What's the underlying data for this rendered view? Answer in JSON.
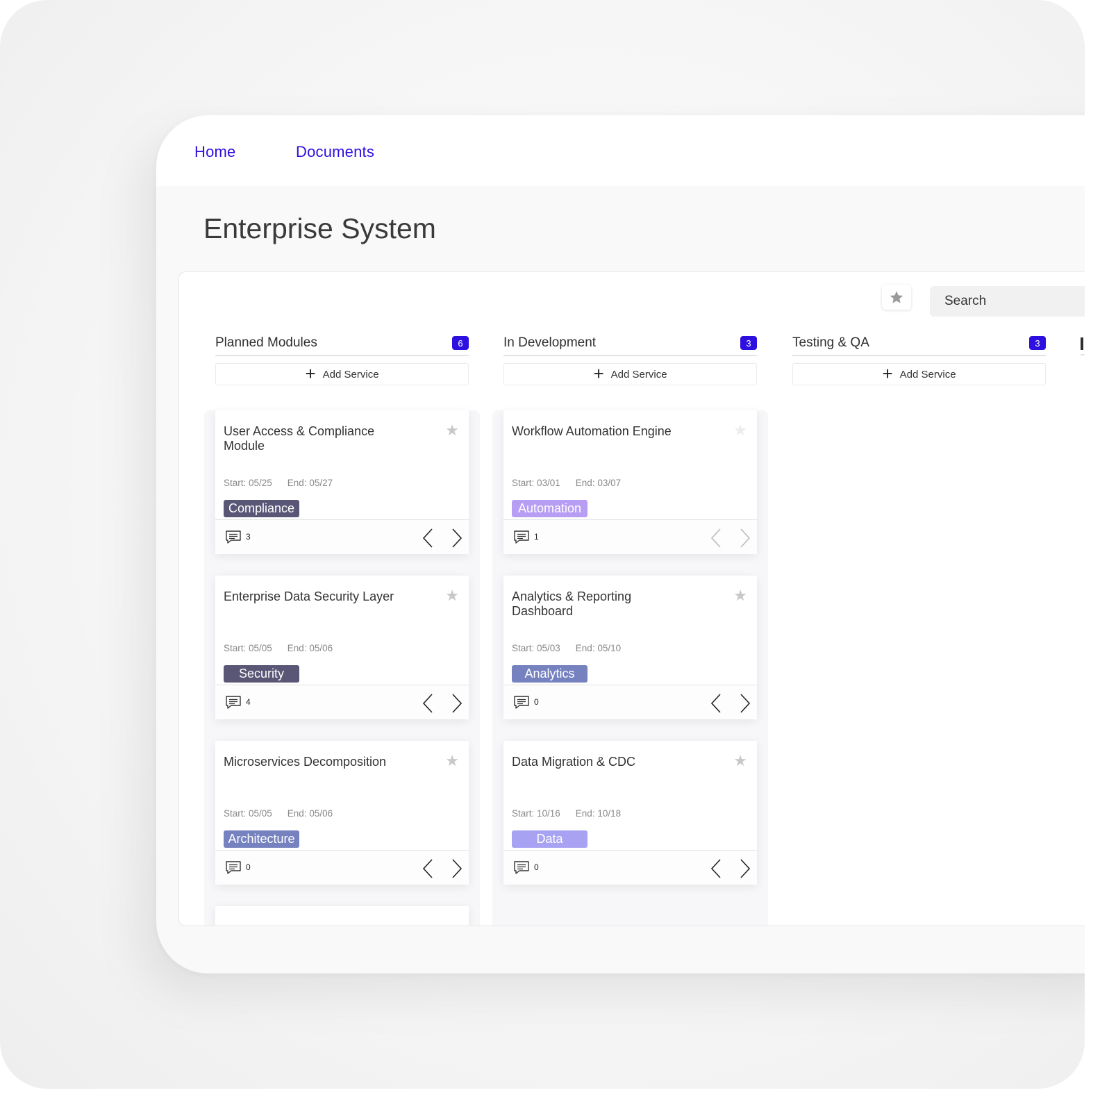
{
  "nav": {
    "home": "Home",
    "documents": "Documents"
  },
  "page_title": "Enterprise System",
  "toolbar": {
    "search_placeholder": "Search",
    "favorites_icon": "star-icon"
  },
  "colors": {
    "accent": "#2d0fe0",
    "tag_compliance": "#5a5676",
    "tag_security": "#5a5676",
    "tag_architecture": "#7582bf",
    "tag_automation": "#b79df4",
    "tag_analytics": "#7582bf",
    "tag_data": "#a7a2f2"
  },
  "columns": [
    {
      "title": "Planned Modules",
      "count": "6",
      "add_label": "Add Service",
      "cards": [
        {
          "title": "User Access & Compliance Module",
          "start": "Start: 05/25",
          "end": "End: 05/27",
          "tag": "Compliance",
          "comments": "3"
        },
        {
          "title": "Enterprise Data Security Layer",
          "start": "Start: 05/05",
          "end": "End: 05/06",
          "tag": "Security",
          "comments": "4"
        },
        {
          "title": "Microservices Decomposition",
          "start": "Start: 05/05",
          "end": "End: 05/06",
          "tag": "Architecture",
          "comments": "0"
        }
      ]
    },
    {
      "title": "In Development",
      "count": "3",
      "add_label": "Add Service",
      "cards": [
        {
          "title": "Workflow Automation Engine",
          "start": "Start: 03/01",
          "end": "End: 03/07",
          "tag": "Automation",
          "comments": "1"
        },
        {
          "title": "Analytics & Reporting Dashboard",
          "start": "Start: 05/03",
          "end": "End: 05/10",
          "tag": "Analytics",
          "comments": "0"
        },
        {
          "title": "Data Migration & CDC",
          "start": "Start: 10/16",
          "end": "End: 10/18",
          "tag": "Data",
          "comments": "0"
        }
      ]
    },
    {
      "title": "Testing & QA",
      "count": "3",
      "add_label": "Add Service",
      "cards": []
    }
  ]
}
